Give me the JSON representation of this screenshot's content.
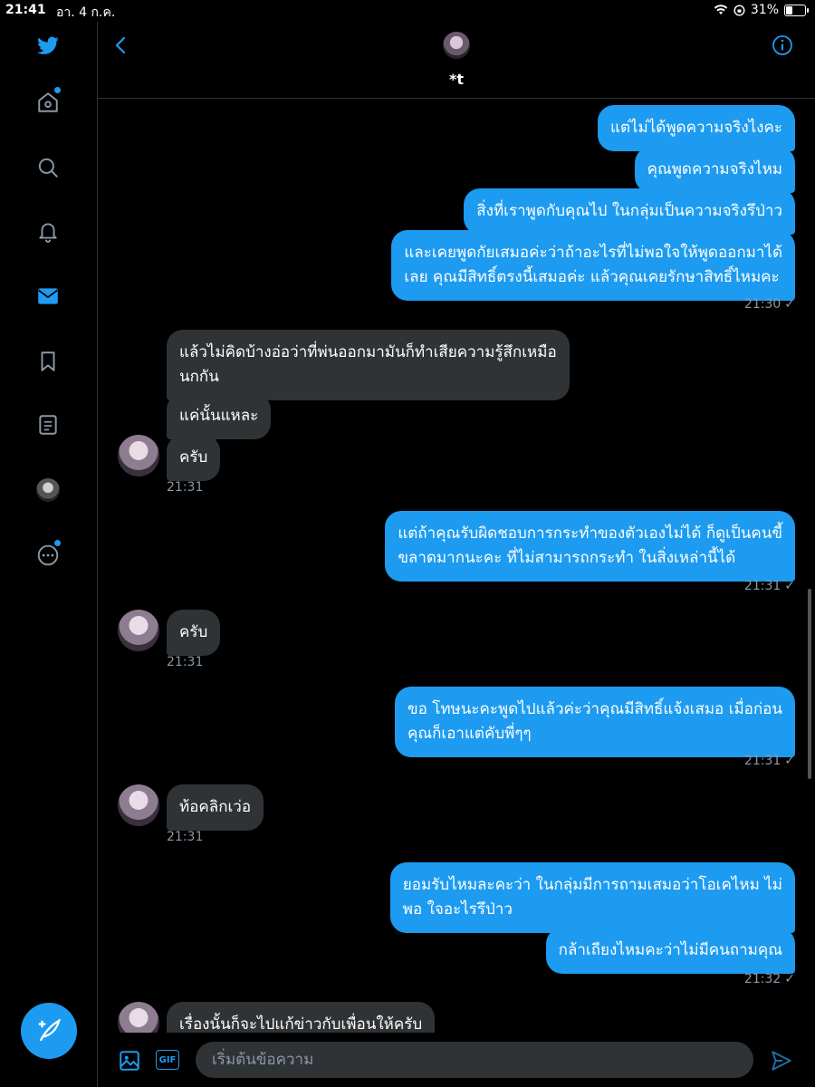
{
  "status": {
    "time": "21:41",
    "date": "อา. 4 ก.ค.",
    "battery": "31%",
    "battery_level": 0.31
  },
  "sidebar": {
    "icons": [
      "twitter-logo-icon",
      "home-icon",
      "search-icon",
      "bell-icon",
      "mail-icon",
      "bookmark-icon",
      "list-icon",
      "profile-avatar",
      "more-icon"
    ],
    "compose_icon": "compose-tweet-icon"
  },
  "header": {
    "name": "*t"
  },
  "messages": {
    "m1": "แต่ไม่ได้พูดความจริงไงคะ",
    "m2": "คุณพูดความจริงไหม",
    "m3": "สิ่งที่เราพูดกับคุณไป ในกลุ่มเป็นความจริงรึป่าว",
    "m4a": "และเคยพูดกัยเสมอค่ะว่าถ้าอะไรที่ไม่พอใจให้พูดออกมาได้",
    "m4b": "เลย คุณมีสิทธิ์ตรงนี้เสมอค่ะ แล้วคุณเคยรักษาสิทธิ์ไหมคะ",
    "t1": "21:30",
    "r1a": "แล้วไม่คิดบ้างอ่อว่าที่พ่นออกมามันก็ทำเสียความรู้สึกเหมือ",
    "r1b": "นกกัน",
    "r2": "แค่นั้นแหละ",
    "r3": "ครับ",
    "t2": "21:31",
    "m5a": "แต่ถ้าคุณรับผิดชอบการกระทำของตัวเองไม่ได้ ก็ดูเป็นคนขี้",
    "m5b": "ขลาดมากนะคะ ที่ไม่สามารถกระทำ ในสิ่งเหล่านี้ได้",
    "t3": "21:31",
    "r4": "ครับ",
    "t4": "21:31",
    "m6a": "ขอ โทษนะคะพูดไปแล้วค่ะว่าคุณมีสิทธิ์แจ้งเสมอ เมื่อก่อน",
    "m6b": "คุณก็เอาแต่คับพี่ๆๆ",
    "t5": "21:31",
    "r5": "ท้อคลิกเว่อ",
    "t6": "21:31",
    "m7a": "ยอมรับไหมละคะว่า ในกลุ่มมีการถามเสมอว่าโอเคไหม ไม่",
    "m7b": "พอ ใจอะไรรึป่าว",
    "m8": "กล้าเถียงไหมคะว่าไม่มีคนถามคุณ",
    "t7": "21:32",
    "r6": "เรื่องนั้นก็จะไปแก้ข่าวกับเพื่อนให้ครับ"
  },
  "composer": {
    "placeholder": "เริ่มต้นข้อความ",
    "gif_label": "GIF"
  },
  "colors": {
    "accent": "#1d9bf0",
    "bubble_received": "#2f3336",
    "background": "#000000"
  }
}
